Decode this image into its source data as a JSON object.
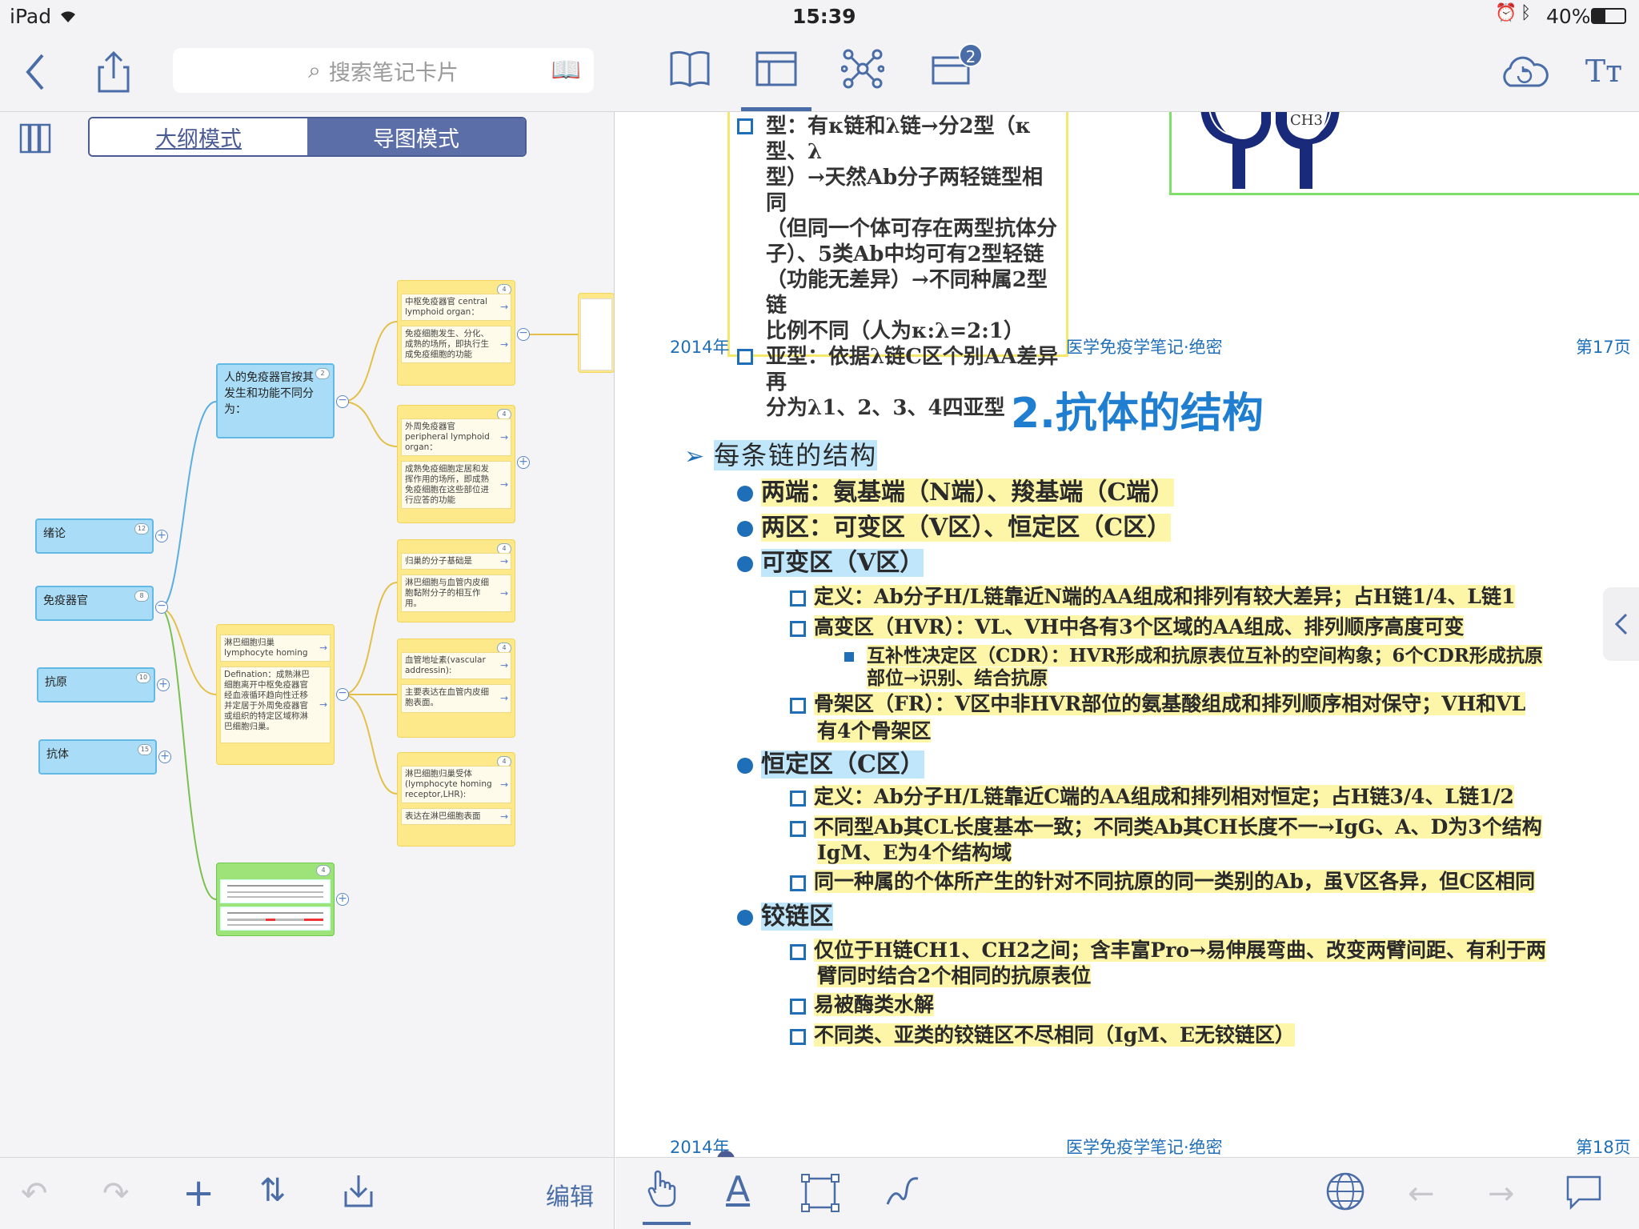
{
  "status_bar": {
    "device": "iPad",
    "time": "15:39",
    "battery": "40%"
  },
  "toolbar": {
    "search_placeholder": "搜索笔记卡片",
    "tabs_badge": "2"
  },
  "outline": {
    "mode_outline": "大纲模式",
    "mode_mindmap": "导图模式"
  },
  "mindmap": {
    "left_nodes": [
      {
        "label": "绪论",
        "badge": "12"
      },
      {
        "label": "免疫器官",
        "badge": "8"
      },
      {
        "label": "抗原",
        "badge": "10"
      },
      {
        "label": "抗体",
        "badge": "15"
      }
    ],
    "hub1": {
      "label": "人的免疫器官按其发生和功能不同分为：",
      "badge": "2"
    },
    "hub2": {
      "title": "淋巴细胞归巢 lymphocyte homing",
      "detail": "Defination：成熟淋巴细胞离开中枢免疫器官经血液循环趋向性迁移并定居于外周免疫器官或组织的特定区域称淋巴细胞归巢。"
    },
    "hub3": {
      "badge": "4"
    },
    "cards": [
      {
        "title": "中枢免疫器官 central lymphoid organ：",
        "detail": "免疫细胞发生、分化、成熟的场所，即执行生成免疫细胞的功能",
        "badge": "4"
      },
      {
        "title": "外周免疫器官 peripheral lymphoid organ：",
        "detail": "成熟免疫细胞定居和发挥作用的场所，即成熟免疫细胞在这些部位进行应答的功能",
        "badge": "4"
      },
      {
        "title": "归巢的分子基础是",
        "detail": "淋巴细胞与血管内皮细胞黏附分子的相互作用。",
        "badge": "4"
      },
      {
        "title": "血管地址素(vascular addressin):",
        "detail": "主要表达在血管内皮细胞表面。",
        "badge": "4"
      },
      {
        "title": "淋巴细胞归巢受体 (lymphocyte homing receptor,LHR):",
        "detail": "表达在淋巴细胞表面",
        "badge": "4"
      }
    ]
  },
  "left_bottom": {
    "edit_label": "编辑"
  },
  "document": {
    "top_block": [
      "型：有κ链和λ链→分2型（κ型、λ",
      "型）→天然Ab分子两轻链型相同",
      "（但同一个体可存在两型抗体分",
      "子）、5类Ab中均可有2型轻链",
      "（功能无差异）→不同种属2型链",
      "比例不同（人为κ:λ=2:1）",
      "亚型：依据λ链C区个别AA差异再",
      "分为λ1、2、3、4四亚型"
    ],
    "figure_label": "CH3",
    "footer17": {
      "year": "2014年",
      "title": "医学免疫学笔记·绝密",
      "page": "第17页"
    },
    "heading": "2.抗体的结构",
    "section": "每条链的结构",
    "lines": [
      "两端：氨基端（N端）、羧基端（C端）",
      "两区：可变区（V区）、恒定区（C区）",
      "可变区（V区）",
      "定义：Ab分子H/L链靠近N端的AA组成和排列有较大差异；占H链1/4、L链1",
      "高变区（HVR）：VL、VH中各有3个区域的AA组成、排列顺序高度可变",
      "互补性决定区（CDR）：HVR形成和抗原表位互补的空间构象；6个CDR形成抗原",
      "部位→识别、结合抗原",
      "骨架区（FR）：V区中非HVR部位的氨基酸组成和排列顺序相对保守；VH和VL",
      "有4个骨架区",
      "恒定区（C区）",
      "定义：Ab分子H/L链靠近C端的AA组成和排列相对恒定；占H链3/4、L链1/2",
      "不同型Ab其CL长度基本一致；不同类Ab其CH长度不一→IgG、A、D为3个结构",
      "IgM、E为4个结构域",
      "同一种属的个体所产生的针对不同抗原的同一类别的Ab，虽V区各异，但C区相同",
      "铰链区",
      "仅位于H链CH1、CH2之间；含丰富Pro→易伸展弯曲、改变两臂间距、有利于两",
      "臂同时结合2个相同的抗原表位",
      "易被酶类水解",
      "不同类、亚类的铰链区不尽相同（IgM、E无铰链区）"
    ],
    "footer18": {
      "year": "2014年",
      "title": "医学免疫学笔记·绝密",
      "page": "第18页"
    }
  },
  "colors": {
    "accent": "#4a6da8",
    "doc_blue": "#1f6fb8",
    "highlight_yellow": "#fdf6a8",
    "highlight_blue": "#bfe6fb"
  }
}
